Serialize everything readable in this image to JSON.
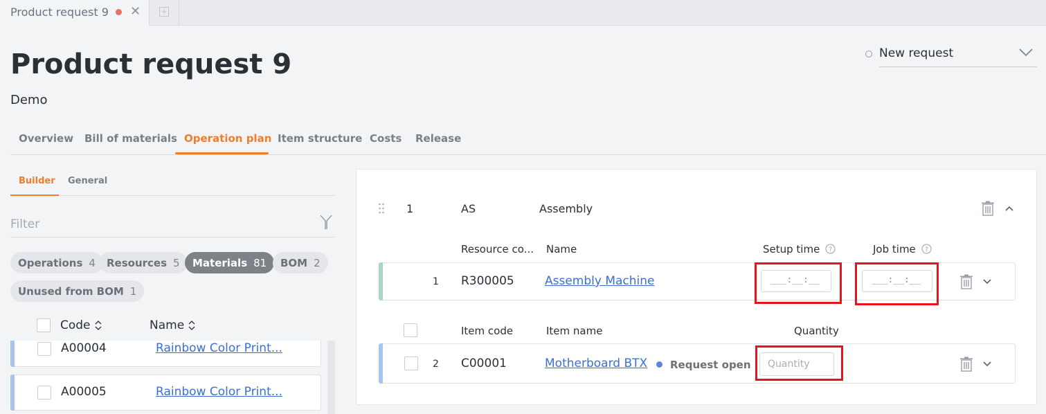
{
  "window": {
    "tab_title": "Product request 9"
  },
  "header": {
    "title": "Product request 9",
    "subtitle": "Demo",
    "status_value": "New request"
  },
  "main_tabs": [
    "Overview",
    "Bill of materials",
    "Operation plan",
    "Item structure",
    "Costs",
    "Release"
  ],
  "main_tab_active": "Operation plan",
  "left_panel": {
    "sub_tabs": [
      "Builder",
      "General"
    ],
    "sub_tab_active": "Builder",
    "filter_placeholder": "Filter",
    "chips": [
      {
        "label": "Operations",
        "count": "4"
      },
      {
        "label": "Resources",
        "count": "5"
      },
      {
        "label": "Materials",
        "count": "81"
      },
      {
        "label": "BOM",
        "count": "2"
      },
      {
        "label": "Unused from BOM",
        "count": "1"
      }
    ],
    "active_chip": "Materials",
    "columns": {
      "code": "Code",
      "name": "Name"
    },
    "rows": [
      {
        "code": "A00004",
        "name": "Rainbow Color Print..."
      },
      {
        "code": "A00005",
        "name": "Rainbow Color Print..."
      }
    ]
  },
  "operation": {
    "number": "1",
    "code": "AS",
    "name": "Assembly",
    "resource_headers": {
      "code": "Resource co...",
      "name": "Name",
      "setup": "Setup time",
      "job": "Job time"
    },
    "resource_row": {
      "number": "1",
      "code": "R300005",
      "name": "Assembly Machine",
      "setup_time": "___:__:__",
      "job_time": "___:__:__"
    },
    "material_headers": {
      "code": "Item code",
      "name": "Item name",
      "quantity": "Quantity"
    },
    "material_row": {
      "number": "2",
      "code": "C00001",
      "name": "Motherboard BTX",
      "status": "Request open",
      "quantity_placeholder": "Quantity"
    }
  },
  "colors": {
    "accent": "#ef7d2b",
    "link": "#3a6fd6",
    "highlight": "#e8141c",
    "resource_bar": "#a8d8c4",
    "material_bar": "#a9c4ec",
    "unsaved_dot": "#e9706a",
    "status_dot": "#5d86db"
  }
}
